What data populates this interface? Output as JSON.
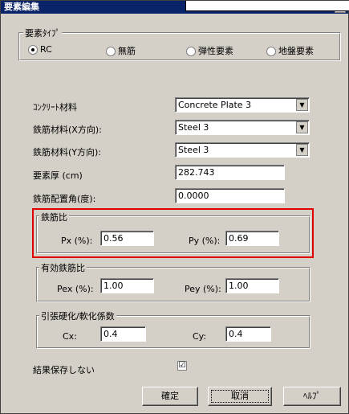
{
  "window": {
    "title": "要素編集",
    "close_label": "✕"
  },
  "element_type": {
    "label": "要素ﾀｲﾌﾟ",
    "options": [
      {
        "label": "RC",
        "selected": true
      },
      {
        "label": "無筋",
        "selected": false
      },
      {
        "label": "弾性要素",
        "selected": false
      },
      {
        "label": "地盤要素",
        "selected": false
      }
    ]
  },
  "fields": {
    "concrete_material": {
      "label": "ｺﾝｸﾘｰﾄ材料",
      "value": "Concrete Plate 3"
    },
    "rebar_x": {
      "label": "鉄筋材料(X方向):",
      "value": "Steel 3"
    },
    "rebar_y": {
      "label": "鉄筋材料(Y方向):",
      "value": "Steel 3"
    },
    "thickness": {
      "label": "要素厚 (cm)",
      "value": "282.743"
    },
    "rebar_angle": {
      "label": "鉄筋配置角(度):",
      "value": "0.0000"
    }
  },
  "rebar_ratio": {
    "label": "鉄筋比",
    "px_label": "Px (%):",
    "px_value": "0.56",
    "py_label": "Py (%):",
    "py_value": "0.69"
  },
  "effective_ratio": {
    "label": "有効鉄筋比",
    "pex_label": "Pex (%):",
    "pex_value": "1.00",
    "pey_label": "Pey (%):",
    "pey_value": "1.00"
  },
  "tension_softening": {
    "label": "引張硬化/軟化係数",
    "cx_label": "Cx:",
    "cx_value": "0.4",
    "cy_label": "Cy:",
    "cy_value": "0.4"
  },
  "no_save": {
    "label": "結果保存しない",
    "checked": true,
    "mark": "☑"
  },
  "buttons": {
    "ok": "確定",
    "cancel": "取消",
    "help": "ﾍﾙﾌﾟ"
  }
}
